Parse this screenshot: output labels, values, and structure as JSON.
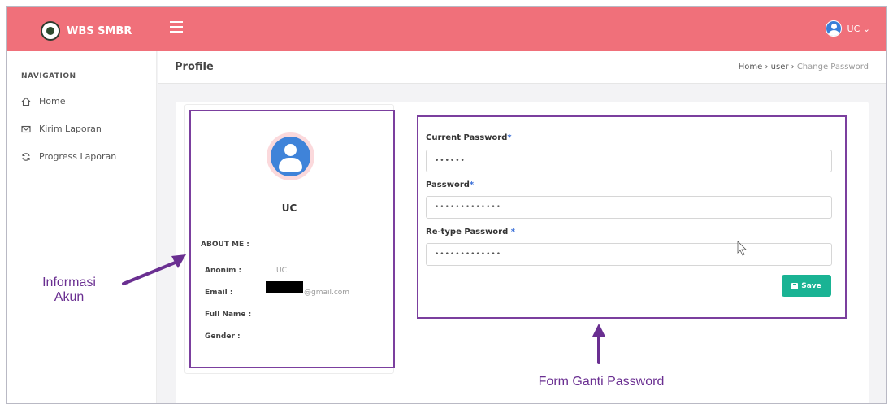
{
  "app": {
    "brand": "WBS SMBR",
    "user_label": "UC ⌄"
  },
  "sidebar": {
    "title": "NAVIGATION",
    "items": [
      {
        "label": "Home",
        "icon": "home-icon"
      },
      {
        "label": "Kirim Laporan",
        "icon": "mail-icon"
      },
      {
        "label": "Progress Laporan",
        "icon": "refresh-icon"
      }
    ]
  },
  "header": {
    "title": "Profile",
    "breadcrumb": {
      "home": "Home",
      "sep1": " › ",
      "user": "user",
      "sep2": " › ",
      "current": "Change Password"
    }
  },
  "profile": {
    "name": "UC",
    "about_title": "ABOUT ME :",
    "fields": [
      {
        "label": "Anonim :",
        "value": "UC"
      },
      {
        "label": "Email :",
        "value": "@gmail.com"
      },
      {
        "label": "Full Name :",
        "value": ""
      },
      {
        "label": "Gender :",
        "value": ""
      }
    ]
  },
  "form": {
    "current_label": "Current Password",
    "current_value": "••••••",
    "password_label": "Password",
    "password_value": "•••••••••••••",
    "retype_label": "Re-type Password ",
    "retype_value": "•••••••••••••",
    "required_mark": "*",
    "save_label": "Save"
  },
  "annotations": {
    "account_info": "Informasi Akun",
    "form_label": "Form Ganti Password"
  },
  "colors": {
    "topbar": "#f0707a",
    "accent": "#1ab394",
    "annotation": "#6a2f91"
  }
}
